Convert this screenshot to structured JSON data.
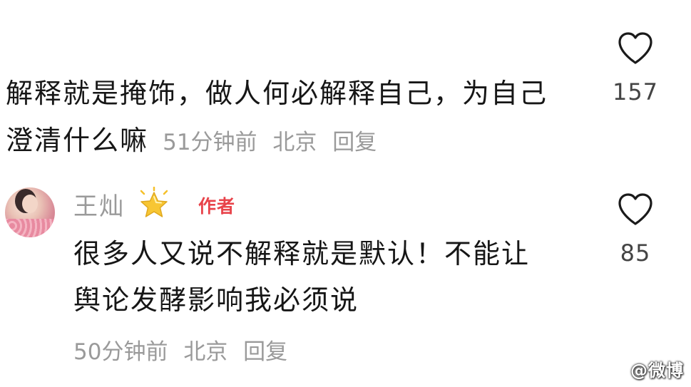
{
  "comment1": {
    "text_line1": "解释就是掩饰，做人何必解释自己，为自己",
    "text_line2": "澄清什么嘛",
    "time": "51分钟前",
    "location": "北京",
    "reply_label": "回复",
    "like_count": "157"
  },
  "comment2": {
    "author": "王灿",
    "author_tag": "作者",
    "text_line1": "很多人又说不解释就是默认！不能让",
    "text_line2": "舆论发酵影响我必须说",
    "time": "50分钟前",
    "location": "北京",
    "reply_label": "回复",
    "like_count": "85"
  },
  "watermark": "@微博",
  "colors": {
    "text": "#161616",
    "meta": "#9a9a9a",
    "author_tag": "#e8434a",
    "star": "#f5c02a"
  },
  "icons": {
    "like": "heart-outline-icon",
    "badge": "star-icon"
  }
}
